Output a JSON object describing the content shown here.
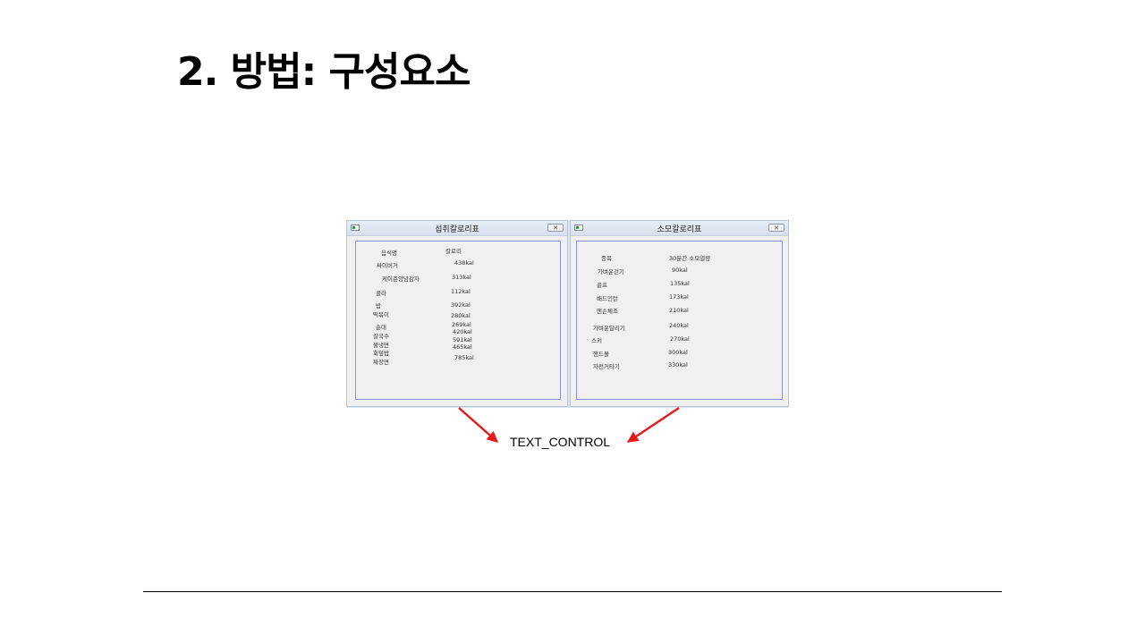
{
  "slide": {
    "title": "2. 방법: 구성요소"
  },
  "caption": "TEXT_CONTROL",
  "colors": {
    "arrow": "#e41b1b",
    "textbox_border": "#8f8ee6"
  },
  "intake_window": {
    "title": "섭취칼로리표",
    "header": {
      "food": "음식명",
      "calorie": "칼로리"
    },
    "foods": [
      "싸이버거",
      "케이준양념감자",
      "콜라",
      "밥",
      "떡볶이",
      "순대",
      "칼국수",
      "물냉면",
      "회덮밥",
      "짜장면"
    ],
    "calories": [
      "438kal",
      "313kal",
      "112kal",
      "392kal",
      "280kal",
      "269kal",
      "420kal",
      "591kal",
      "465kal",
      "785kal"
    ]
  },
  "burn_window": {
    "title": "소모칼로리표",
    "header": {
      "activity": "종목",
      "burn": "30분간 소모열량"
    },
    "activities": [
      "가벼운걷기",
      "골프",
      "배드민턴",
      "맨손체조",
      "가벼운달리기",
      "스키",
      "핸드볼",
      "자전거타기"
    ],
    "values": [
      "90kal",
      "135kal",
      "173kal",
      "210kal",
      "240kal",
      "270kal",
      "300kal",
      "330kal"
    ]
  }
}
